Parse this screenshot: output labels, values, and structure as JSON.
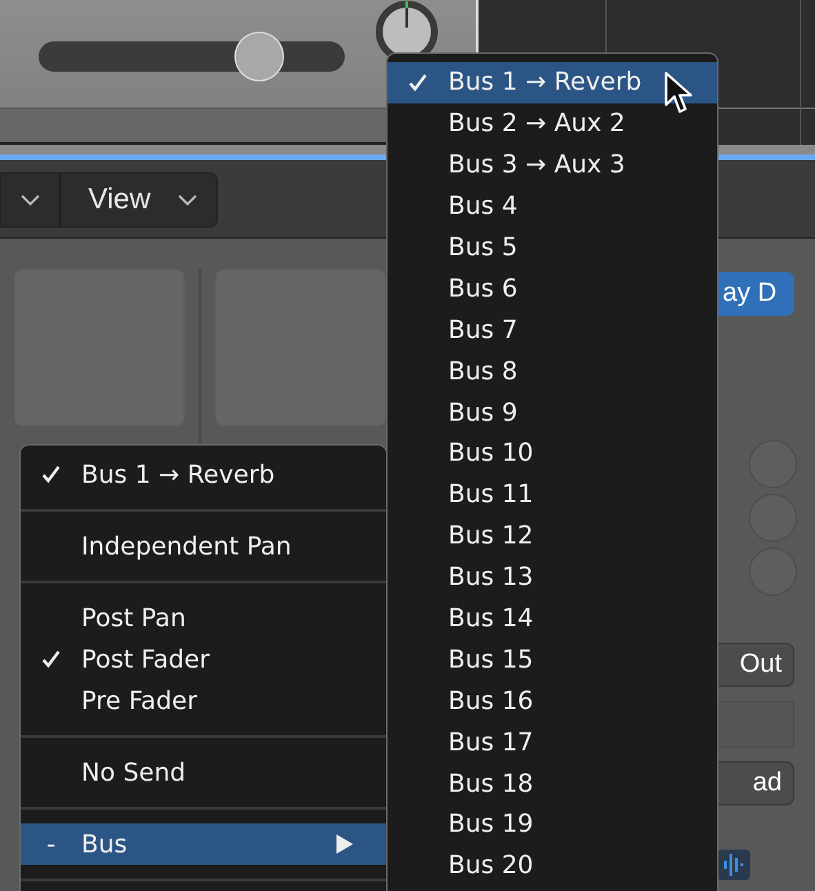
{
  "top": {
    "fader": {
      "level": 0.72
    }
  },
  "toolbar": {
    "view_button": "View"
  },
  "strip": {
    "insert": "ay D",
    "output": "Out",
    "automation": "ad"
  },
  "send_menu": {
    "items": [
      {
        "kind": "item",
        "label": "Bus 1 → Reverb",
        "checked": true,
        "selected": false
      },
      {
        "kind": "separator"
      },
      {
        "kind": "item",
        "label": "Independent Pan",
        "checked": false,
        "selected": false
      },
      {
        "kind": "separator"
      },
      {
        "kind": "item",
        "label": "Post Pan",
        "checked": false,
        "selected": false
      },
      {
        "kind": "item",
        "label": "Post Fader",
        "checked": true,
        "selected": false
      },
      {
        "kind": "item",
        "label": "Pre Fader",
        "checked": false,
        "selected": false
      },
      {
        "kind": "separator"
      },
      {
        "kind": "item",
        "label": "No Send",
        "checked": false,
        "selected": false
      },
      {
        "kind": "separator"
      },
      {
        "kind": "submenu",
        "prefix": "-",
        "label": "Bus",
        "checked": false,
        "selected": true
      },
      {
        "kind": "separator"
      }
    ]
  },
  "bus_menu": {
    "items": [
      {
        "label": "Bus 1 → Reverb",
        "checked": true,
        "selected": true
      },
      {
        "label": "Bus 2 → Aux 2",
        "checked": false,
        "selected": false
      },
      {
        "label": "Bus 3 → Aux 3",
        "checked": false,
        "selected": false
      },
      {
        "label": "Bus 4",
        "checked": false,
        "selected": false
      },
      {
        "label": "Bus 5",
        "checked": false,
        "selected": false
      },
      {
        "label": "Bus 6",
        "checked": false,
        "selected": false
      },
      {
        "label": "Bus 7",
        "checked": false,
        "selected": false
      },
      {
        "label": "Bus 8",
        "checked": false,
        "selected": false
      },
      {
        "label": "Bus 9",
        "checked": false,
        "selected": false
      },
      {
        "label": "Bus 10",
        "checked": false,
        "selected": false
      },
      {
        "label": "Bus 11",
        "checked": false,
        "selected": false
      },
      {
        "label": "Bus 12",
        "checked": false,
        "selected": false
      },
      {
        "label": "Bus 13",
        "checked": false,
        "selected": false
      },
      {
        "label": "Bus 14",
        "checked": false,
        "selected": false
      },
      {
        "label": "Bus 15",
        "checked": false,
        "selected": false
      },
      {
        "label": "Bus 16",
        "checked": false,
        "selected": false
      },
      {
        "label": "Bus 17",
        "checked": false,
        "selected": false
      },
      {
        "label": "Bus 18",
        "checked": false,
        "selected": false
      },
      {
        "label": "Bus 19",
        "checked": false,
        "selected": false
      },
      {
        "label": "Bus 20",
        "checked": false,
        "selected": false
      }
    ]
  }
}
